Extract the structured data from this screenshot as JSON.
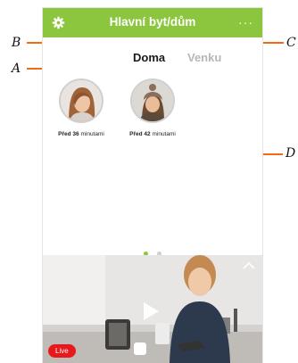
{
  "header": {
    "title": "Hlavní byt/dům",
    "settings_icon": "gear-icon",
    "more_icon": "more-horizontal-icon",
    "more_label": "···",
    "background_color": "#8cc63f"
  },
  "tabs": [
    {
      "label": "Doma",
      "active": true
    },
    {
      "label": "Venku",
      "active": false
    }
  ],
  "contacts": [
    {
      "time_prefix": "Před",
      "time_value": "36",
      "time_unit": "minutami"
    },
    {
      "time_prefix": "Před",
      "time_value": "42",
      "time_unit": "minutami"
    }
  ],
  "pager": {
    "total": 2,
    "active_index": 0
  },
  "video": {
    "live_label": "Live",
    "play_icon": "play-icon",
    "collapse_icon": "chevron-up-icon",
    "live_color": "#e8191c"
  },
  "callouts": {
    "a": "A",
    "b": "B",
    "c": "C",
    "d": "D",
    "color": "#f26b10"
  }
}
